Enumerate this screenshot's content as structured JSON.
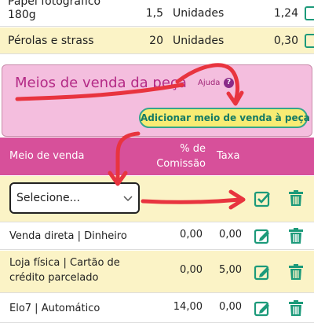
{
  "materials": [
    {
      "name_line1": "Papel fotográfico",
      "name_line2": "180g",
      "qty": "1,5",
      "unit": "Unidades",
      "price": "1,24"
    },
    {
      "name": "Pérolas e strass",
      "qty": "20",
      "unit": "Unidades",
      "price": "0,30"
    }
  ],
  "panel": {
    "title": "Meios de venda da peça",
    "help_label": "Ajuda",
    "help_icon": "?",
    "add_button": "Adicionar meio de venda à peça"
  },
  "table": {
    "headers": {
      "sale_method": "Meio de venda",
      "commission_line1": "% de",
      "commission_line2": "Comissão",
      "tax": "Taxa"
    },
    "select_placeholder": "Selecione...",
    "rows": [
      {
        "line1": "Venda direta | Dinheiro",
        "line2": "",
        "commission": "0,00",
        "tax": "0,00"
      },
      {
        "line1": "Loja física | Cartão de",
        "line2": "crédito parcelado",
        "commission": "0,00",
        "tax": "5,00"
      },
      {
        "line1": "Elo7 | Automático",
        "line2": "",
        "commission": "14,00",
        "tax": "0,00"
      }
    ]
  },
  "colors": {
    "accent_pink": "#d7509a",
    "panel_pink": "#f4bede",
    "row_yellow": "#fbf3c6",
    "icon_green": "#1c9a7a",
    "annotation_red": "#e8343f"
  },
  "icons": [
    "edit-icon",
    "confirm-icon",
    "trash-icon",
    "chevron-down-icon",
    "help-icon"
  ]
}
